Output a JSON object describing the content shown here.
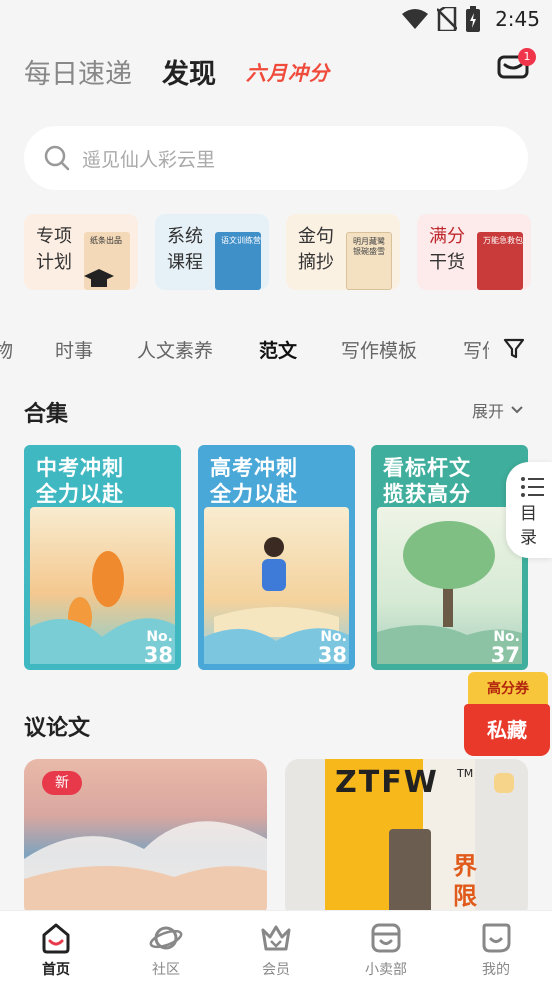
{
  "status": {
    "time": "2:45"
  },
  "top_tabs": [
    {
      "label": "每日速递"
    },
    {
      "label": "发现"
    },
    {
      "label": "六月冲分"
    }
  ],
  "mail_badge": "1",
  "search": {
    "placeholder": "遥见仙人彩云里"
  },
  "quick_cards": [
    {
      "line1": "专项",
      "line2": "计划",
      "book": "纸条出品",
      "bg": "#fdeee3",
      "book_color": "#f3d9b8"
    },
    {
      "line1": "系统",
      "line2": "课程",
      "book": "语文训练营",
      "bg": "#e6f1f7",
      "book_color": "#3f8fc9"
    },
    {
      "line1": "金句",
      "line2": "摘抄",
      "book": "明月藏鹭 银碗盛雪",
      "bg": "#fbf1e3",
      "book_color": "#f3e1c2"
    },
    {
      "line1": "满分",
      "line2": "干货",
      "book": "万能急救包",
      "bg": "#fdeaea",
      "book_color": "#c93a3a"
    }
  ],
  "category_tabs": [
    "物",
    "时事",
    "人文素养",
    "范文",
    "写作模板",
    "写作"
  ],
  "active_category": "范文",
  "collections_section": {
    "title": "合集",
    "expand": "展开"
  },
  "collections": [
    {
      "title1": "中考冲刺",
      "title2": "全力以赴",
      "no_label": "No.",
      "no": "38",
      "bg": "#3fb8c2",
      "art": "#f6dfb4"
    },
    {
      "title1": "高考冲刺",
      "title2": "全力以赴",
      "no_label": "No.",
      "no": "38",
      "bg": "#4aa8d8",
      "art": "#f4dcb0"
    },
    {
      "title1": "看标杆文",
      "title2": "揽获高分",
      "no_label": "No.",
      "no": "37",
      "bg": "#3fae9c",
      "art": "#d9ead8"
    }
  ],
  "toc": {
    "label": "目录"
  },
  "promo": {
    "top": "高分券",
    "bottom": "私藏"
  },
  "essay_section": {
    "title": "议论文",
    "new_badge": "新",
    "card2_brand": "ZTFW",
    "card2_tm": "TM",
    "card2_word": "界限"
  },
  "bottom_nav": [
    {
      "label": "首页",
      "active": true
    },
    {
      "label": "社区",
      "active": false
    },
    {
      "label": "会员",
      "active": false
    },
    {
      "label": "小卖部",
      "active": false
    },
    {
      "label": "我的",
      "active": false
    }
  ]
}
